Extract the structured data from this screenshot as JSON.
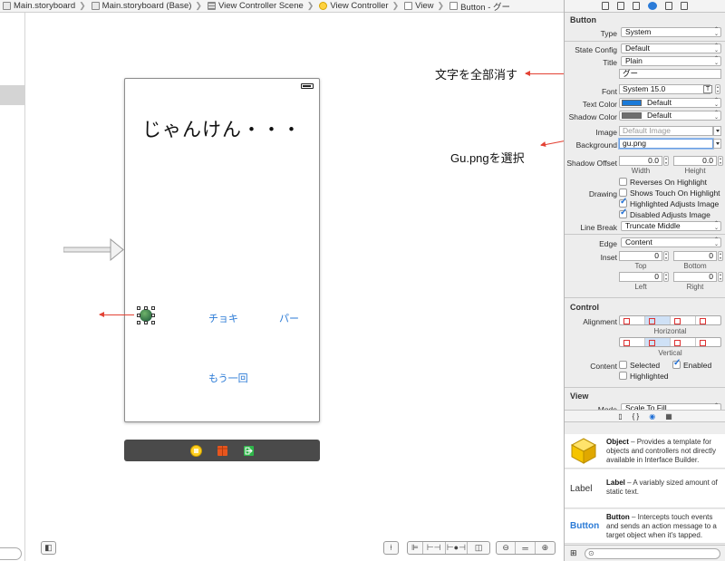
{
  "breadcrumb": [
    {
      "label": "Main.storyboard",
      "icon": "storyboard-file-icon"
    },
    {
      "label": "Main.storyboard (Base)",
      "icon": "storyboard-file-icon"
    },
    {
      "label": "View Controller Scene",
      "icon": "scene-icon"
    },
    {
      "label": "View Controller",
      "icon": "view-controller-icon"
    },
    {
      "label": "View",
      "icon": "view-icon"
    },
    {
      "label": "Button - グー",
      "icon": "button-icon"
    }
  ],
  "scene": {
    "title": "じゃんけん・・・",
    "choki_label": "チョキ",
    "pa_label": "パー",
    "again_label": "もう一回"
  },
  "annotations": {
    "title_note": "文字を全部消す",
    "background_note": "Gu.pngを選択"
  },
  "inspector": {
    "button_section": "Button",
    "type_label": "Type",
    "type_value": "System",
    "state_label": "State Config",
    "state_value": "Default",
    "title_label": "Title",
    "title_value": "Plain",
    "title_text": "グー",
    "font_label": "Font",
    "font_value": "System 15.0",
    "text_color_label": "Text Color",
    "text_color_value": "Default",
    "shadow_color_label": "Shadow Color",
    "shadow_color_value": "Default",
    "image_label": "Image",
    "image_placeholder": "Default Image",
    "background_label": "Background",
    "background_value": "gu.png",
    "shadow_offset_label": "Shadow Offset",
    "shadow_w": "0.0",
    "shadow_h": "0.0",
    "width_label": "Width",
    "height_label": "Height",
    "drawing_label": "Drawing",
    "reverses": "Reverses On Highlight",
    "shows_touch": "Shows Touch On Highlight",
    "highlighted_adjusts": "Highlighted Adjusts Image",
    "disabled_adjusts": "Disabled Adjusts Image",
    "line_break_label": "Line Break",
    "line_break_value": "Truncate Middle",
    "edge_label": "Edge",
    "edge_value": "Content",
    "inset_label": "Inset",
    "inset_top": "0",
    "inset_bottom": "0",
    "inset_left": "0",
    "inset_right": "0",
    "top_label": "Top",
    "bottom_label": "Bottom",
    "left_label": "Left",
    "right_label": "Right",
    "control_section": "Control",
    "alignment_label": "Alignment",
    "horizontal_label": "Horizontal",
    "vertical_label": "Vertical",
    "content_label": "Content",
    "selected_label": "Selected",
    "enabled_label": "Enabled",
    "highlighted_label": "Highlighted",
    "view_section": "View",
    "mode_label": "Mode",
    "mode_value": "Scale To Fill",
    "text_color_hex": "#1a7ad8",
    "shadow_color_hex": "#6e6e6e"
  },
  "library": [
    {
      "title": "Object",
      "desc": " – Provides a template for objects and controllers not directly available in Interface Builder.",
      "icon": "object-cube-icon"
    },
    {
      "title": "Label",
      "desc": " – A variably sized amount of static text.",
      "icon": "label-icon",
      "glyph": "Label"
    },
    {
      "title": "Button",
      "desc": " – Intercepts touch events and sends an action message to a target object when it's tapped.",
      "icon": "button-icon",
      "glyph": "Button"
    }
  ],
  "colors": {
    "accent": "#2a7ad6",
    "annotation_arrow": "#e34234"
  }
}
